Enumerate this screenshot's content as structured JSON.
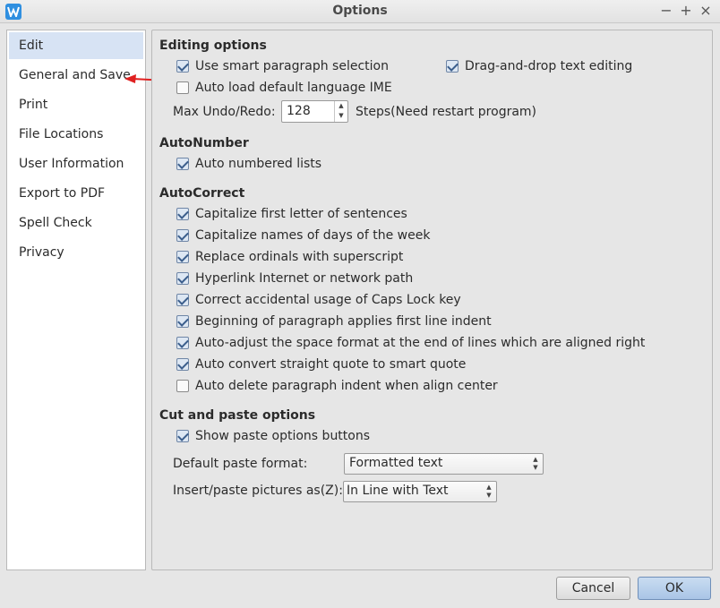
{
  "window": {
    "title": "Options",
    "controls": {
      "minimize": "−",
      "maximize": "+",
      "close": "×"
    }
  },
  "sidebar": {
    "items": [
      {
        "label": "Edit",
        "selected": true
      },
      {
        "label": "General and Save"
      },
      {
        "label": "Print"
      },
      {
        "label": "File Locations"
      },
      {
        "label": "User Information"
      },
      {
        "label": "Export to PDF"
      },
      {
        "label": "Spell Check"
      },
      {
        "label": "Privacy"
      }
    ]
  },
  "annotation": {
    "arrow_color": "#e02020"
  },
  "editing": {
    "title": "Editing options",
    "smart_paragraph": {
      "label": "Use smart paragraph selection",
      "checked": true
    },
    "drag_drop": {
      "label": "Drag-and-drop text editing",
      "checked": true
    },
    "auto_ime": {
      "label": "Auto load default language IME",
      "checked": false
    },
    "undo_label": "Max Undo/Redo:",
    "undo_value": "128",
    "undo_suffix": "Steps(Need restart program)"
  },
  "autonumber": {
    "title": "AutoNumber",
    "items": [
      {
        "label": "Auto numbered lists",
        "checked": true
      }
    ]
  },
  "autocorrect": {
    "title": "AutoCorrect",
    "items": [
      {
        "label": "Capitalize first letter of sentences",
        "checked": true
      },
      {
        "label": "Capitalize names of days of the week",
        "checked": true
      },
      {
        "label": "Replace ordinals with superscript",
        "checked": true
      },
      {
        "label": "Hyperlink Internet or network path",
        "checked": true
      },
      {
        "label": "Correct accidental usage of Caps Lock key",
        "checked": true
      },
      {
        "label": "Beginning of paragraph applies first line indent",
        "checked": true
      },
      {
        "label": "Auto-adjust the space format at the end of lines which are aligned right",
        "checked": true
      },
      {
        "label": "Auto convert straight quote to smart quote",
        "checked": true
      },
      {
        "label": "Auto delete paragraph indent when align center",
        "checked": false
      }
    ]
  },
  "cutpaste": {
    "title": "Cut and paste options",
    "show_paste": {
      "label": "Show paste options buttons",
      "checked": true
    },
    "default_format_label": "Default paste format:",
    "default_format_value": "Formatted text",
    "pictures_label": "Insert/paste pictures as(Z):",
    "pictures_value": "In Line with Text"
  },
  "footer": {
    "cancel": "Cancel",
    "ok": "OK"
  }
}
